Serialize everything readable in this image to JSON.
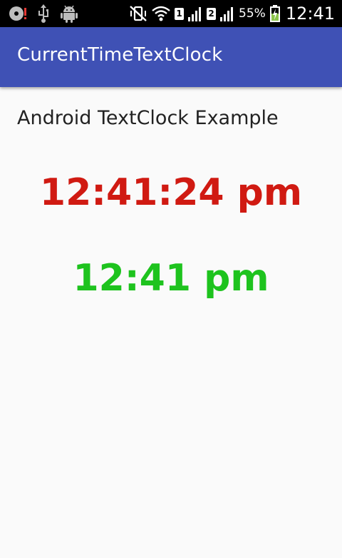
{
  "status_bar": {
    "left_icons": [
      "disk-alert-icon",
      "usb-icon",
      "android-debug-icon"
    ],
    "right_icons": [
      "vibrate-off-icon",
      "wifi-icon",
      "signal-icon",
      "signal-icon"
    ],
    "sim1_label": "1",
    "sim2_label": "2",
    "battery_percent": "55%",
    "time": "12:41"
  },
  "app_bar": {
    "title": "CurrentTimeTextClock",
    "color": "#3f51b5"
  },
  "main": {
    "heading": "Android TextClock Example",
    "clock_with_seconds": "12:41:24 pm",
    "clock_with_seconds_color": "#d01a12",
    "clock_without_seconds": "12:41 pm",
    "clock_without_seconds_color": "#1ec31e"
  }
}
